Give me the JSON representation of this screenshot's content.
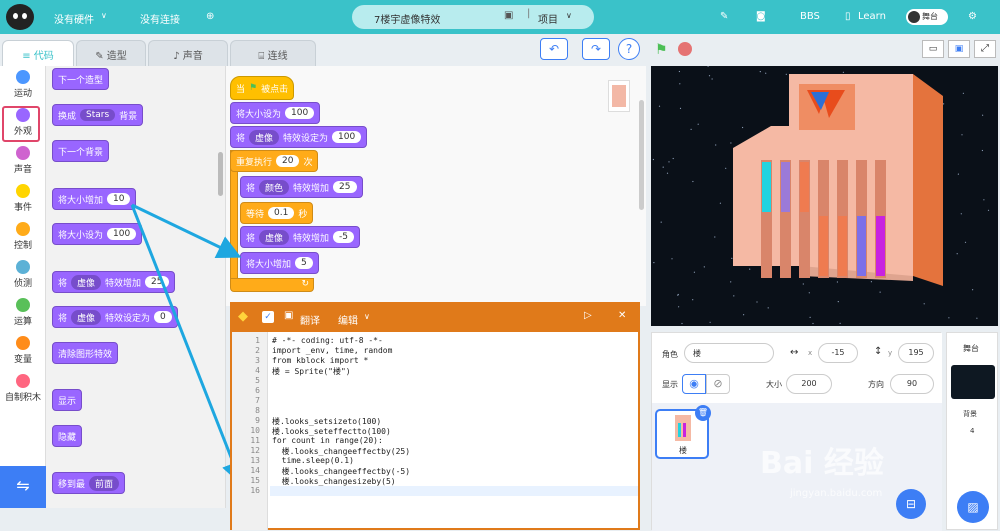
{
  "topbar": {
    "hardware": "没有硬件",
    "connection": "没有连接",
    "project_title": "7楼宇虚像特效",
    "project_menu": "项目",
    "bbs": "BBS",
    "learn": "Learn",
    "stage_toggle": "舞台"
  },
  "tabs": [
    "代码",
    "造型",
    "声音",
    "连线"
  ],
  "categories": [
    {
      "label": "运动",
      "color": "#4c97ff"
    },
    {
      "label": "外观",
      "color": "#9966ff"
    },
    {
      "label": "声音",
      "color": "#cf63cf"
    },
    {
      "label": "事件",
      "color": "#ffd500"
    },
    {
      "label": "控制",
      "color": "#ffab19"
    },
    {
      "label": "侦测",
      "color": "#5cb1d6"
    },
    {
      "label": "运算",
      "color": "#59c059"
    },
    {
      "label": "变量",
      "color": "#ff8c1a"
    },
    {
      "label": "自制积木",
      "color": "#ff6680"
    }
  ],
  "palette": {
    "next_costume": "下一个造型",
    "switch_bg": "换成",
    "switch_bg_val": "Stars",
    "switch_bg_suffix": "背景",
    "next_bg": "下一个背景",
    "change_size": "将大小增加",
    "change_size_val": "10",
    "set_size": "将大小设为",
    "set_size_val": "100",
    "change_effect_pre": "将",
    "change_effect_dd": "虚像",
    "change_effect_mid": "特效增加",
    "change_effect_val": "25",
    "set_effect_pre": "将",
    "set_effect_dd": "虚像",
    "set_effect_mid": "特效设定为",
    "set_effect_val": "0",
    "clear_effects": "清除图形特效",
    "show": "显示",
    "hide": "隐藏",
    "goto_layer": "移到最",
    "goto_layer_val": "前面"
  },
  "script": {
    "when_flag_pre": "当",
    "when_flag_post": "被点击",
    "set_size": "将大小设为",
    "set_size_val": "100",
    "set_effect_pre": "将",
    "set_effect_dd": "虚像",
    "set_effect_mid": "特效设定为",
    "set_effect_val": "100",
    "repeat": "重复执行",
    "repeat_val": "20",
    "repeat_post": "次",
    "change1_pre": "将",
    "change1_dd": "颜色",
    "change1_mid": "特效增加",
    "change1_val": "25",
    "wait": "等待",
    "wait_val": "0.1",
    "wait_post": "秒",
    "change2_pre": "将",
    "change2_dd": "虚像",
    "change2_mid": "特效增加",
    "change2_val": "-5",
    "change_size": "将大小增加",
    "change_size_val": "5"
  },
  "python": {
    "translate": "翻译",
    "edit": "编辑",
    "lines": [
      "# -*- coding: utf-8 -*-",
      "import _env, time, random",
      "from kblock import *",
      "楼 = Sprite(\"楼\")",
      "",
      "",
      "",
      "",
      "楼.looks_setsizeto(100)",
      "楼.looks_seteffectto(100)",
      "for count in range(20):",
      "  楼.looks_changeeffectby(25)",
      "  time.sleep(0.1)",
      "  楼.looks_changeeffectby(-5)",
      "  楼.looks_changesizeby(5)",
      ""
    ],
    "line_numbers": [
      "1",
      "2",
      "3",
      "4",
      "5",
      "6",
      "7",
      "8",
      "9",
      "10",
      "11",
      "12",
      "13",
      "14",
      "15",
      "16"
    ]
  },
  "sprite": {
    "role_label": "角色",
    "role_name": "楼",
    "x": "-15",
    "y": "195",
    "show_label": "显示",
    "size_label": "大小",
    "size": "200",
    "dir_label": "方向",
    "dir": "90",
    "thumb_name": "楼"
  },
  "backdrop": {
    "title": "舞台",
    "label": "背景",
    "count": "4"
  },
  "watermark": "Bai 经验",
  "watermark_url": "jingyan.baidu.com"
}
